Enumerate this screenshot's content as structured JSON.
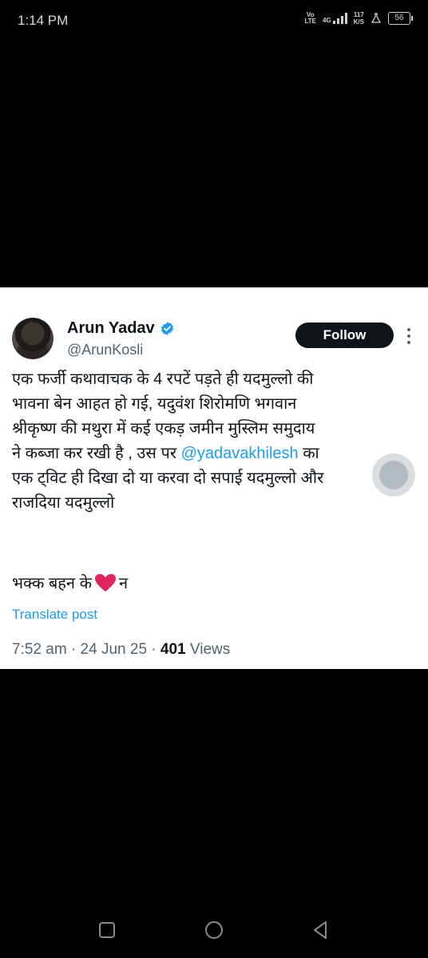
{
  "status_bar": {
    "time": "1:14 PM",
    "volte_top": "Vo",
    "volte_bottom": "LTE",
    "network": "4G",
    "speed_value": "117",
    "speed_unit": "K/S",
    "battery": "56",
    "icons": [
      "volte-icon",
      "signal-icon",
      "data-speed-icon",
      "flask-icon",
      "battery-icon"
    ]
  },
  "tweet": {
    "author": {
      "display_name": "Arun Yadav",
      "handle": "@ArunKosli",
      "verified": true
    },
    "follow_label": "Follow",
    "lines": [
      "एक फर्जी कथावाचक के 4 रपटें पड़ते ही यदमुल्लो की",
      "भावना बेन आहत हो गई, यदुवंश शिरोमणि भगवान",
      "श्रीकृष्ण की मथुरा में कई एकड़ जमीन मुस्लिम समुदाय",
      "ने कब्जा कर रखी है , उस पर",
      "एक ट्विट ही दिखा दो या करवा दो सपाई यदमुल्लो और",
      "राजदिया यदमुल्लो"
    ],
    "mention": "@yadavakhilesh",
    "after_mention": " का",
    "tail_before_heart": "भक्क बहन के",
    "tail_after_heart": "न",
    "translate_label": "Translate post",
    "time": "7:52 am",
    "date": "24 Jun 25",
    "views_count": "401",
    "views_label": "Views",
    "separator": "·"
  },
  "colors": {
    "accent": "#1d9bf0",
    "text_primary": "#0f1419",
    "text_secondary": "#536471",
    "heart": "#e0245e"
  },
  "nav_bar": {
    "buttons": [
      "recents-icon",
      "home-icon",
      "back-icon"
    ]
  }
}
